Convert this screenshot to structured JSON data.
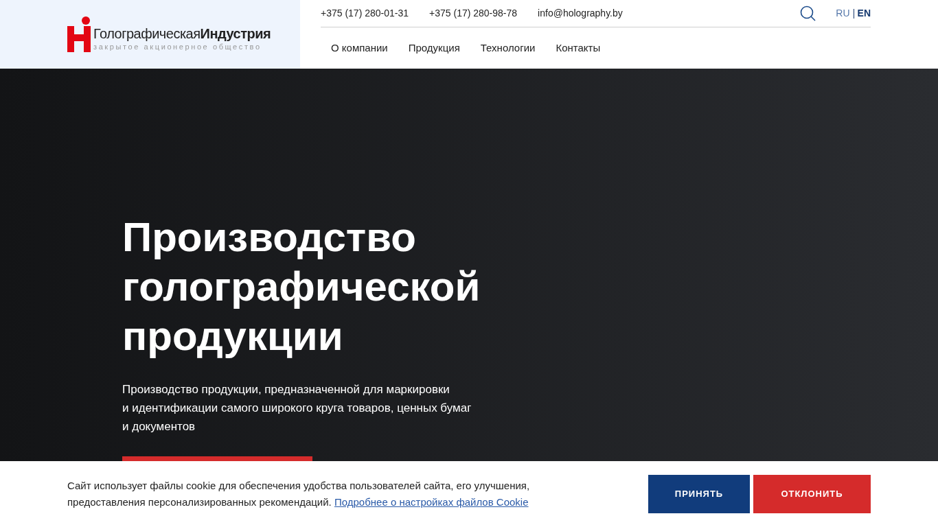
{
  "logo": {
    "name": "Голографическая**Индустрия**",
    "subtitle": "закрытое акционерное общество"
  },
  "contacts": [
    "+375 (17) 280-01-31",
    "+375 (17) 280-98-78",
    "info@holography.by"
  ],
  "languages": [
    {
      "label": "RU",
      "selected": false
    },
    {
      "label": "EN",
      "selected": true
    }
  ],
  "nav": [
    "О компании",
    "Продукция",
    "Технологии",
    "Контакты"
  ],
  "hero": {
    "title": "Производство голографической продукции",
    "text": [
      "Производство продукции, предназначенной для маркировки",
      "и идентификации самого широкого круга товаров, ценных бумаг",
      "и документов"
    ]
  },
  "cookie": {
    "text": "Сайт использует файлы cookie для обеспечения удобства пользователей сайта, его улучшения, предоставления персонализированных рекомендаций.",
    "link": "Подробнее о настройках файлов Cookie",
    "buttons": [
      {
        "label": "ПРИНЯТЬ",
        "kind": "accept"
      },
      {
        "label": "ОТКЛОНИТЬ",
        "kind": "decline"
      }
    ]
  }
}
